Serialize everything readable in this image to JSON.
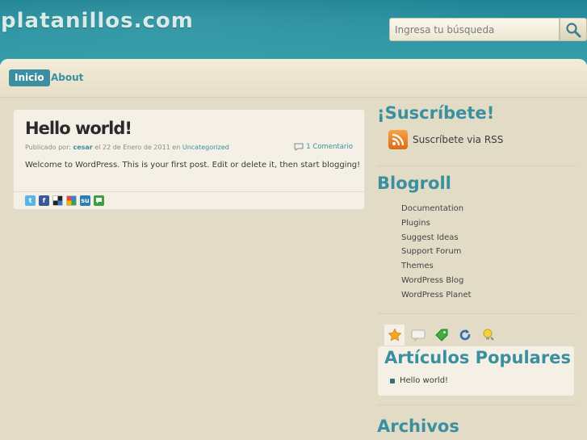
{
  "header": {
    "site_title": "platanillos.com",
    "search_placeholder": "Ingresa tu búsqueda"
  },
  "nav": {
    "items": [
      {
        "label": "Inicio",
        "active": true
      },
      {
        "label": "About",
        "active": false
      }
    ]
  },
  "post": {
    "title": "Hello world!",
    "meta_prefix": "Publicado por:",
    "author": "cesar",
    "meta_date": "el 22 de Enero de 2011 en",
    "category": "Uncategorized",
    "comments": "1 Comentario",
    "body": "Welcome to WordPress. This is your first post. Edit or delete it, then start blogging!",
    "share_icons": [
      "twitter-icon",
      "facebook-icon",
      "delicious-icon",
      "google-icon",
      "stumbleupon-icon",
      "technorati-icon"
    ]
  },
  "sidebar": {
    "subscribe_title": "¡Suscríbete!",
    "rss_label": "Suscríbete via RSS",
    "blogroll_title": "Blogroll",
    "blogroll": [
      "Documentation",
      "Plugins",
      "Suggest Ideas",
      "Support Forum",
      "Themes",
      "WordPress Blog",
      "WordPress Planet"
    ],
    "tabs": [
      "star-icon",
      "comment-icon",
      "tag-icon",
      "refresh-icon",
      "lightbulb-icon"
    ],
    "popular_title": "Artículos Populares",
    "popular_items": [
      "Hello world!"
    ],
    "archives_title": "Archivos"
  },
  "colors": {
    "accent": "#3a8fa0",
    "header_bg": "#2a8f9f",
    "page_bg": "#e2dbc5"
  }
}
